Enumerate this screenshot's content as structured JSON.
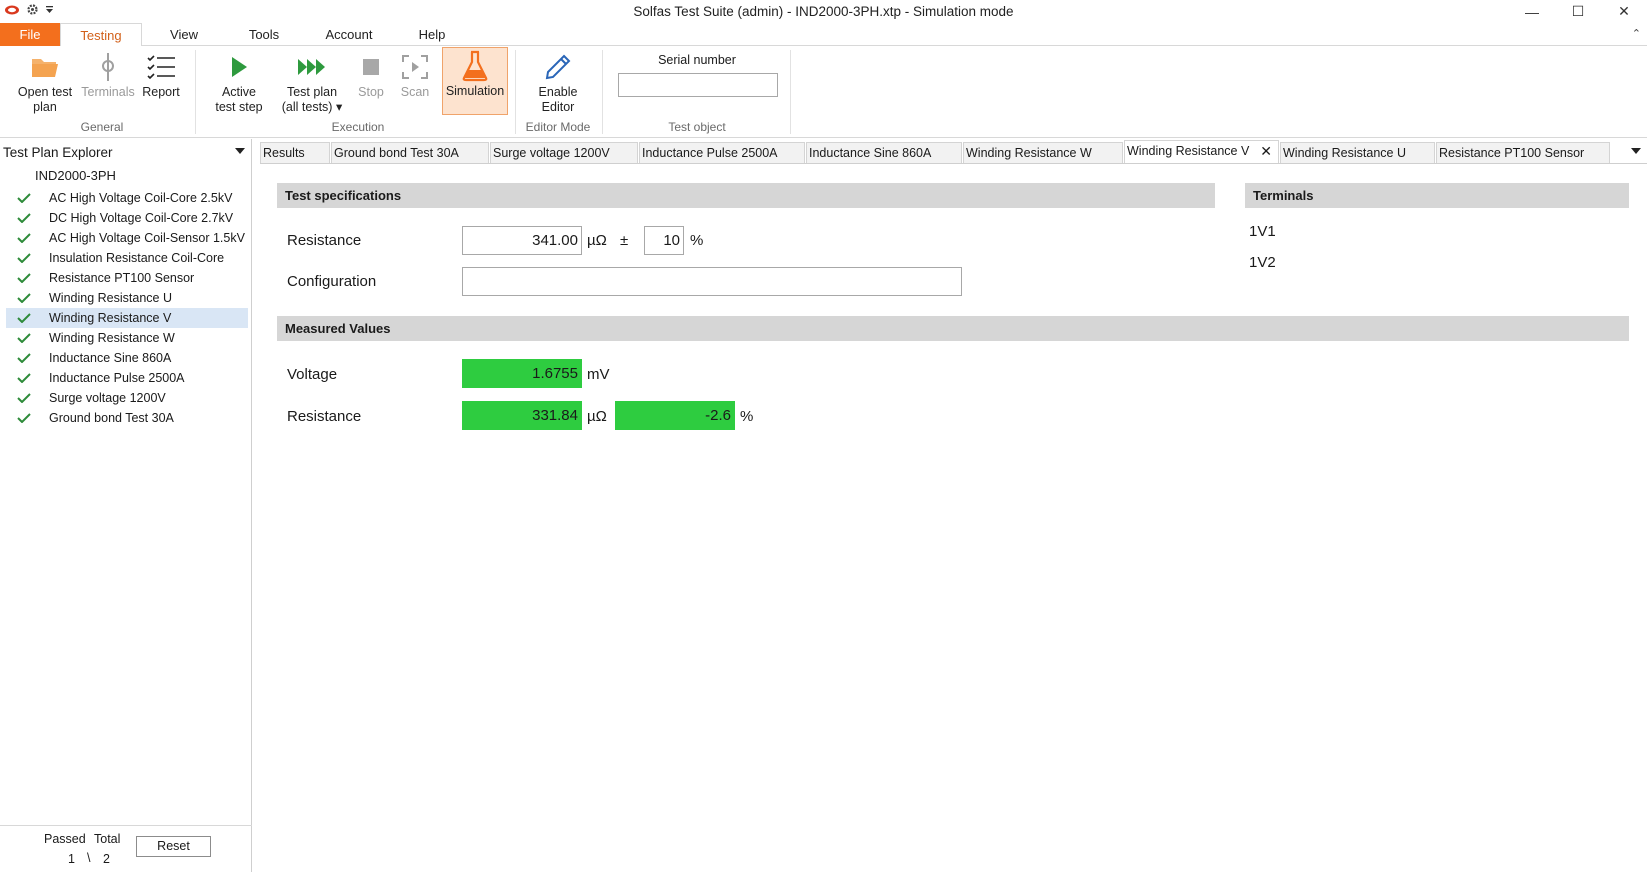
{
  "window": {
    "title": "Solfas Test Suite (admin)  - IND2000-3PH.xtp - Simulation mode",
    "minimize_glyph": "—",
    "maximize_glyph": "☐",
    "close_glyph": "✕"
  },
  "ribbon_tabs": [
    "File",
    "Testing",
    "View",
    "Tools",
    "Account",
    "Help"
  ],
  "ribbon": {
    "general": {
      "label": "General",
      "open_test_plan_l1": "Open test",
      "open_test_plan_l2": "plan",
      "terminals": "Terminals",
      "report": "Report"
    },
    "execution": {
      "label": "Execution",
      "active_l1": "Active",
      "active_l2": "test step",
      "plan_l1": "Test plan",
      "plan_l2": "(all tests) ▾",
      "stop": "Stop",
      "scan": "Scan",
      "simulation": "Simulation"
    },
    "editor_mode": {
      "label": "Editor Mode",
      "enable_l1": "Enable",
      "enable_l2": "Editor"
    },
    "test_object": {
      "label": "Test object",
      "serial_label": "Serial number",
      "serial_value": ""
    }
  },
  "explorer": {
    "title": "Test Plan Explorer",
    "root": "IND2000-3PH",
    "items": [
      "AC High Voltage Coil-Core 2.5kV",
      "DC High Voltage Coil-Core 2.7kV",
      "AC High Voltage Coil-Sensor 1.5kV",
      "Insulation Resistance Coil-Core",
      "Resistance PT100 Sensor",
      "Winding Resistance U",
      "Winding Resistance  V",
      "Winding Resistance  W",
      "Inductance Sine 860A",
      "Inductance Pulse 2500A",
      "Surge voltage 1200V",
      "Ground bond Test 30A"
    ],
    "selected_index": 6,
    "footer": {
      "passed_label": "Passed",
      "total_label": "Total",
      "passed_value": "1",
      "separator": "\\",
      "total_value": "2",
      "reset": "Reset"
    }
  },
  "doc_tabs": [
    "Results",
    "Ground bond Test 30A",
    "Surge voltage 1200V",
    "Inductance Pulse 2500A",
    "Inductance Sine 860A",
    "Winding Resistance  W",
    "Winding Resistance  V",
    "Winding Resistance U",
    "Resistance PT100 Sensor"
  ],
  "active_doc_tab": 6,
  "specs": {
    "header": "Test specifications",
    "resistance_label": "Resistance",
    "resistance_value": "341.00",
    "resistance_unit": "µΩ",
    "pm": "±",
    "tolerance_value": "10",
    "tolerance_unit": "%",
    "configuration_label": "Configuration",
    "configuration_value": ""
  },
  "terminals": {
    "header": "Terminals",
    "items": [
      "1V1",
      "1V2"
    ]
  },
  "measured": {
    "header": "Measured Values",
    "voltage_label": "Voltage",
    "voltage_value": "1.6755",
    "voltage_unit": "mV",
    "resistance_label": "Resistance",
    "resistance_value": "331.84",
    "resistance_unit": "µΩ",
    "deviation_value": "-2.6",
    "deviation_unit": "%"
  },
  "colors": {
    "accent": "#f36f1d",
    "pass_green": "#2ecc40",
    "check_green": "#2e8b3a",
    "selected_row": "#d9e6f5"
  }
}
